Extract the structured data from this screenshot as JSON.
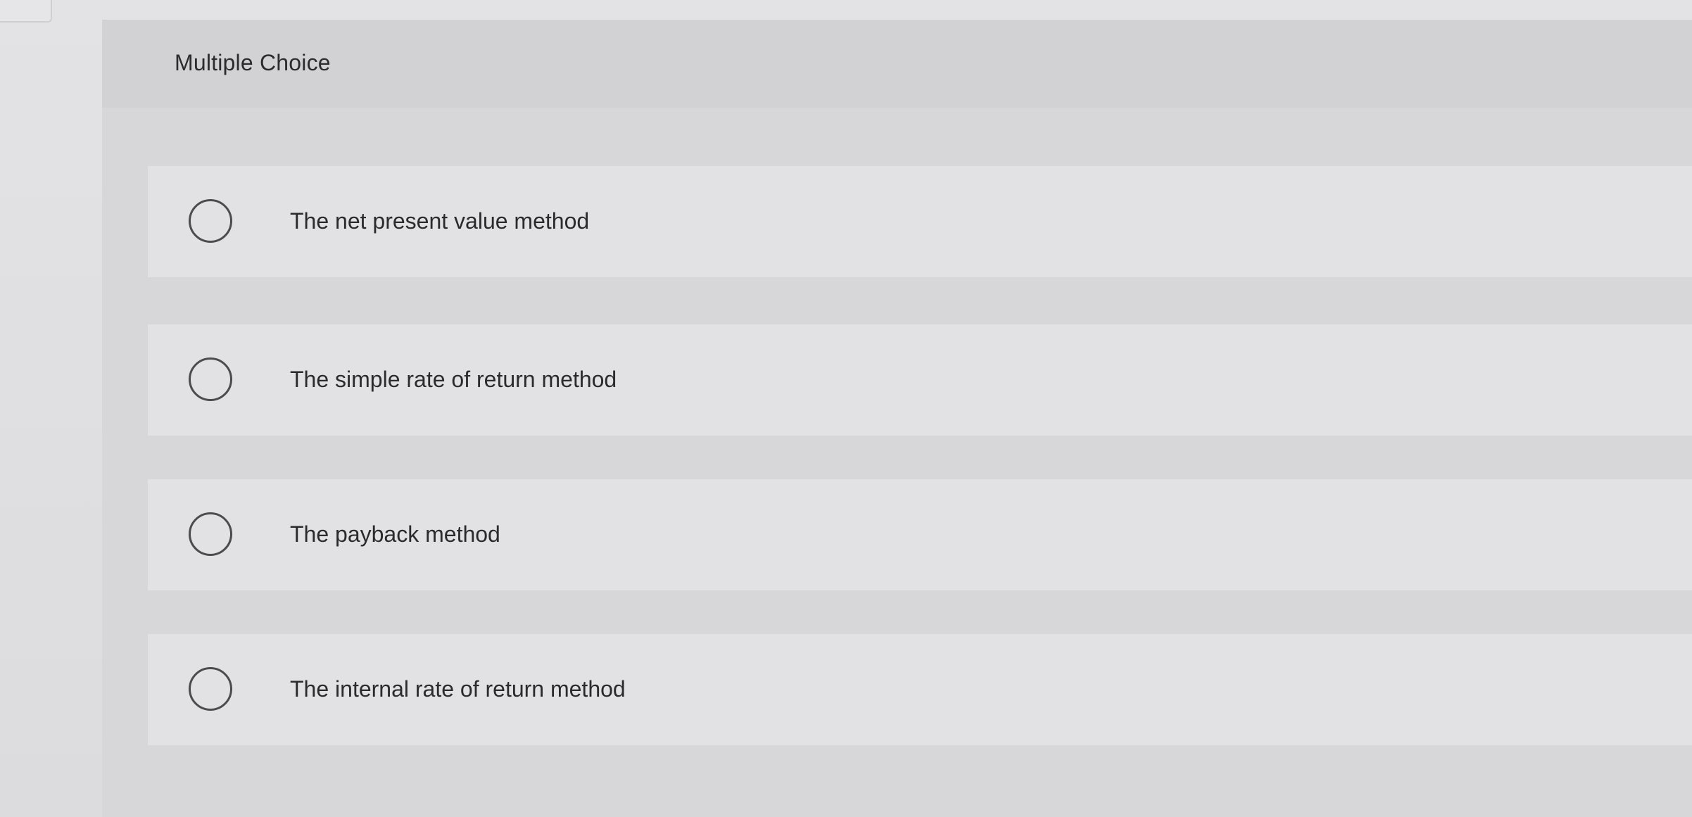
{
  "question": {
    "type_label": "Multiple Choice",
    "choices": [
      {
        "label": "The net present value method",
        "selected": false
      },
      {
        "label": "The simple rate of return method",
        "selected": false
      },
      {
        "label": "The payback method",
        "selected": false
      },
      {
        "label": "The internal rate of return method",
        "selected": false
      }
    ]
  },
  "colors": {
    "background": "#e3e3e5",
    "panel": "#d7d7da",
    "choice_background": "#e2e2e4",
    "text": "#2b2b2e",
    "radio_border": "#4b4b50"
  },
  "icons": {
    "radio": "radio-unchecked-icon"
  }
}
